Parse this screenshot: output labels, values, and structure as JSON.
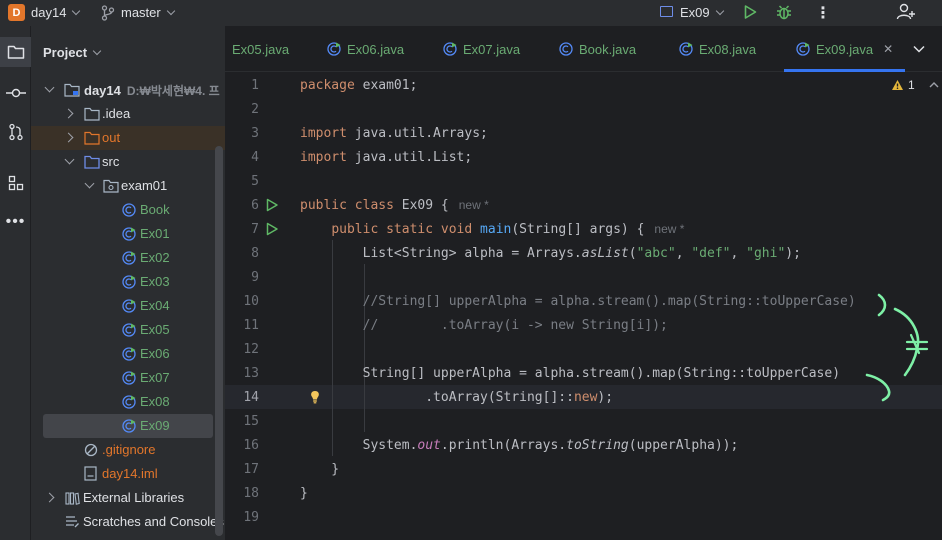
{
  "titlebar": {
    "project_badge": "D",
    "project_name": "day14",
    "branch_name": "master",
    "run_config": "Ex09"
  },
  "project_panel": {
    "title": "Project",
    "tree": [
      {
        "label": "day14",
        "path": "D:₩박세현₩4. 프",
        "icon": "module-folder-icon",
        "depth": 0,
        "expanded": true,
        "bold": true
      },
      {
        "label": ".idea",
        "icon": "folder-icon",
        "depth": 1,
        "expanded": false
      },
      {
        "label": "out",
        "icon": "excluded-folder-icon",
        "depth": 1,
        "expanded": false,
        "color": "#e2762b"
      },
      {
        "label": "src",
        "icon": "source-folder-icon",
        "depth": 1,
        "expanded": true
      },
      {
        "label": "exam01",
        "icon": "package-icon",
        "depth": 2,
        "expanded": true
      },
      {
        "label": "Book",
        "icon": "class-icon",
        "depth": 3,
        "color": "#6aab73"
      },
      {
        "label": "Ex01",
        "icon": "runnable-class-icon",
        "depth": 3,
        "color": "#6aab73"
      },
      {
        "label": "Ex02",
        "icon": "runnable-class-icon",
        "depth": 3,
        "color": "#6aab73"
      },
      {
        "label": "Ex03",
        "icon": "runnable-class-icon",
        "depth": 3,
        "color": "#6aab73"
      },
      {
        "label": "Ex04",
        "icon": "runnable-class-icon",
        "depth": 3,
        "color": "#6aab73"
      },
      {
        "label": "Ex05",
        "icon": "runnable-class-icon",
        "depth": 3,
        "color": "#6aab73"
      },
      {
        "label": "Ex06",
        "icon": "runnable-class-icon",
        "depth": 3,
        "color": "#6aab73"
      },
      {
        "label": "Ex07",
        "icon": "runnable-class-icon",
        "depth": 3,
        "color": "#6aab73"
      },
      {
        "label": "Ex08",
        "icon": "runnable-class-icon",
        "depth": 3,
        "color": "#6aab73"
      },
      {
        "label": "Ex09",
        "icon": "runnable-class-icon",
        "depth": 3,
        "color": "#6aab73",
        "selected": true
      },
      {
        "label": ".gitignore",
        "icon": "ignore-file-icon",
        "depth": 2,
        "color": "#e2762b"
      },
      {
        "label": "day14.iml",
        "icon": "iml-file-icon",
        "depth": 2,
        "color": "#e2762b"
      },
      {
        "label": "External Libraries",
        "icon": "libraries-icon",
        "depth": 0,
        "expanded": false
      },
      {
        "label": "Scratches and Consoles",
        "icon": "scratches-icon",
        "depth": 0
      }
    ]
  },
  "tabs": [
    {
      "label": "Ex05.java",
      "icon": "runnable-class-icon"
    },
    {
      "label": "Ex06.java",
      "icon": "runnable-class-icon"
    },
    {
      "label": "Ex07.java",
      "icon": "runnable-class-icon"
    },
    {
      "label": "Book.java",
      "icon": "class-icon"
    },
    {
      "label": "Ex08.java",
      "icon": "runnable-class-icon"
    },
    {
      "label": "Ex09.java",
      "icon": "runnable-class-icon",
      "active": true
    }
  ],
  "editor": {
    "warning_count": "1",
    "current_line": 14,
    "inlay_hint": "new *",
    "lines": [
      "package exam01;",
      "",
      "import java.util.Arrays;",
      "import java.util.List;",
      "",
      "public class Ex09 {",
      "    public static void main(String[] args) {",
      "        List<String> alpha = Arrays.asList(\"abc\", \"def\", \"ghi\");",
      "",
      "        //String[] upperAlpha = alpha.stream().map(String::toUpperCase)",
      "        //        .toArray(i -> new String[i]);",
      "",
      "        String[] upperAlpha = alpha.stream().map(String::toUpperCase)",
      "                .toArray(String[]::new);",
      "",
      "        System.out.println(Arrays.toString(upperAlpha));",
      "    }",
      "}",
      ""
    ]
  },
  "colors": {
    "accent": "#3574f0",
    "keyword": "#cf8e6d",
    "string": "#6aab73",
    "method": "#56a8f5",
    "comment": "#7a7e85",
    "annotation_ink": "#7ef0a6"
  }
}
